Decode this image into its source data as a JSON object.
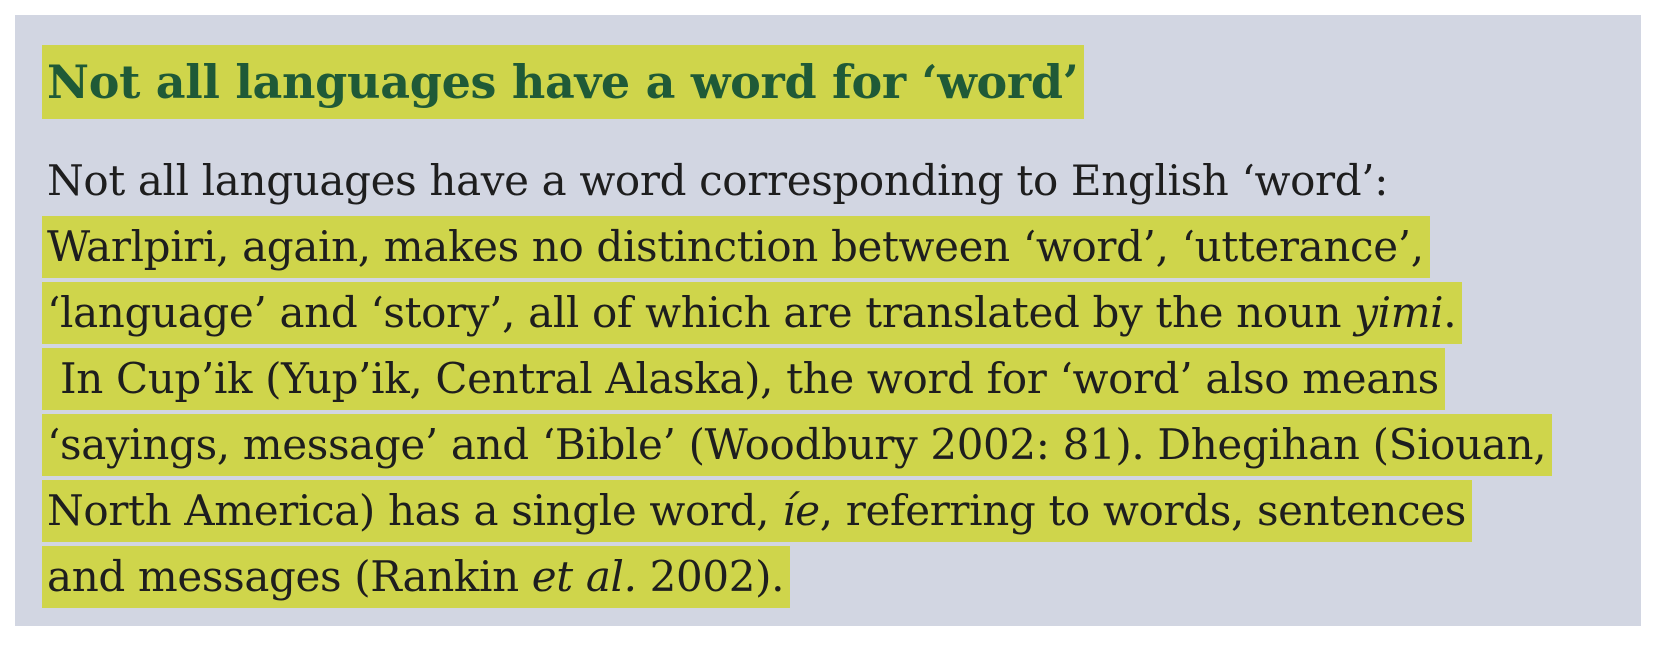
{
  "heading": "Not all languages have a word for ‘word’",
  "paragraph": {
    "line1": "Not all languages have a word corresponding to English ‘word’:",
    "line2": "Warlpiri, again, makes no distinction between ‘word’, ‘utterance’,",
    "line3_a": "‘language’ and ‘story’, all of which are translated by the noun ",
    "line3_i": "yimi",
    "line3_b": ".",
    "line4": " In Cup’ik (Yup’ik, Central Alaska), the word for ‘word’ also means",
    "line5": "‘sayings, message’ and ‘Bible’ (Woodbury 2002: 81). Dhegihan (Siouan,",
    "line6_a": "North America) has a single word, ",
    "line6_i": "íe",
    "line6_b": ", referring to words, sentences",
    "line7_a": "and messages (Rankin ",
    "line7_i": "et al.",
    "line7_b": " 2002)."
  },
  "colors": {
    "box_background": "#d2d6e2",
    "highlight": "#cfd54b",
    "heading_text": "#1f5a37",
    "body_text": "#1e1e1e"
  }
}
